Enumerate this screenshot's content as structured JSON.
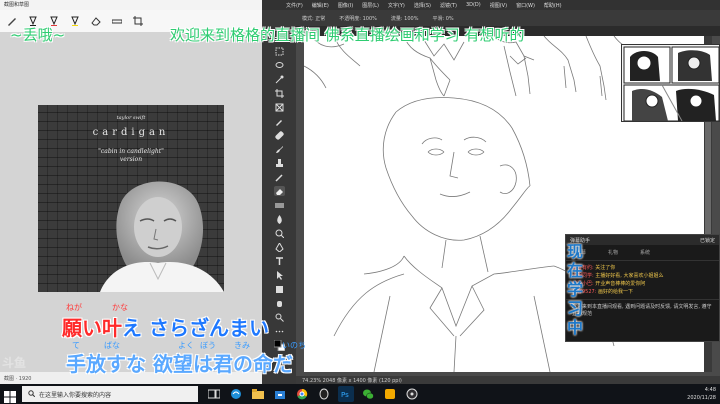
{
  "snipping_tool": {
    "title": "截图和草图",
    "status": "截图 · 1920"
  },
  "album": {
    "artist": "taylor swift",
    "title": "cardigan",
    "subtitle_line1": "\"cabin in candlelight\"",
    "subtitle_line2": "version"
  },
  "photoshop": {
    "menu": [
      "文件(F)",
      "编辑(E)",
      "图像(I)",
      "图层(L)",
      "文字(Y)",
      "选择(S)",
      "滤镜(T)",
      "3D(D)",
      "视图(V)",
      "窗口(W)",
      "帮助(H)"
    ],
    "options": {
      "mode_label": "模式:",
      "mode_value": "正常",
      "opacity_label": "不透明度:",
      "opacity_value": "100%",
      "flow_label": "流量:",
      "flow_value": "100%",
      "smoothing_label": "平滑:",
      "smoothing_value": "0%"
    },
    "tab": "RGB/8",
    "status": "74.23%    2048 像素 x 1400 像素 (120 ppi)"
  },
  "banner": {
    "left": "~丢哦~",
    "main": "欢迎来到格格的直播间    佛系直播绘画和学习    有想听的"
  },
  "live_status": "现在学习中",
  "chat": {
    "header": "弹幕助手",
    "header_right": "已锁定",
    "tabs": [
      "弹幕",
      "礼物",
      "系统"
    ],
    "messages": [
      {
        "user": "黄昏有约:",
        "text": "关注了你"
      },
      {
        "user": "小明同学:",
        "text": "主播好好看, 大家喜欢小姐姐么"
      },
      {
        "user": "鸡汤小巴:",
        "text": "开业声音棒棒的爱你阿"
      },
      {
        "user": "游客9527:",
        "text": "画好的给我一下"
      }
    ],
    "notice": "欢迎来到本直播间观看, 遇到问题请及时反馈, 请文明发言, 遵守直播规范"
  },
  "lyrics": {
    "line1_furigana": [
      {
        "text": "ねが",
        "color": "#ff3b3b"
      },
      {
        "text": "かな",
        "color": "#ff3b3b"
      }
    ],
    "line1_highlight": "願い叶",
    "line1_rest_a": "え ",
    "line1_rest_b": "さらざんまい",
    "line2_furigana": [
      {
        "text": "て",
        "color": "#3b9cff"
      },
      {
        "text": "ばな",
        "color": "#3b9cff"
      },
      {
        "text": "よく",
        "color": "#3b9cff"
      },
      {
        "text": "ぼう",
        "color": "#3b9cff"
      },
      {
        "text": "きみ",
        "color": "#3b9cff"
      },
      {
        "text": "いのち",
        "color": "#3b9cff"
      }
    ],
    "line2": "手放すな 欲望は君の命だ"
  },
  "watermark": "斗鱼",
  "taskbar": {
    "search_placeholder": "在这里输入你要搜索的内容",
    "time": "4:48",
    "date": "2020/11/28"
  },
  "colors": {
    "banner_green": "#2ecc71",
    "lyric_red": "#ff2a2a",
    "lyric_blue": "#5aa8ff",
    "chat_user_red": "#ff5b5b"
  },
  "icons": [
    "pen-icon",
    "highlighter-icon",
    "eraser-icon",
    "crop-icon",
    "save-icon",
    "search-icon",
    "windows-start-icon"
  ]
}
